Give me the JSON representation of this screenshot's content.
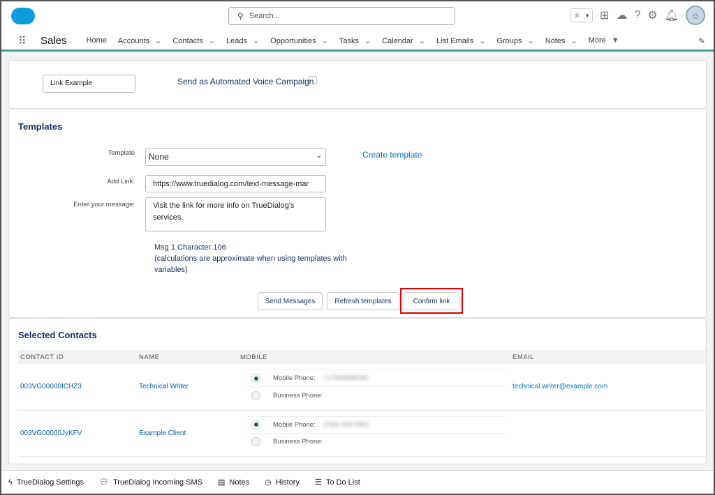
{
  "header": {
    "search_placeholder": "Search...",
    "icons": [
      "star-icon",
      "plus-icon",
      "trailhead-icon",
      "help-icon",
      "gear-icon",
      "bell-icon",
      "avatar"
    ]
  },
  "nav": {
    "app_name": "Sales",
    "items": [
      {
        "label": "Home",
        "dropdown": false
      },
      {
        "label": "Accounts",
        "dropdown": true
      },
      {
        "label": "Contacts",
        "dropdown": true
      },
      {
        "label": "Leads",
        "dropdown": true
      },
      {
        "label": "Opportunities",
        "dropdown": true
      },
      {
        "label": "Tasks",
        "dropdown": true
      },
      {
        "label": "Calendar",
        "dropdown": true
      },
      {
        "label": "List Emails",
        "dropdown": true
      },
      {
        "label": "Groups",
        "dropdown": true
      },
      {
        "label": "Notes",
        "dropdown": true
      },
      {
        "label": "More",
        "dropdown": true
      }
    ]
  },
  "top_card": {
    "campaign_name": "Link Example",
    "voice_label": "Send as Automated Voice Campaign",
    "voice_checked": false
  },
  "templates": {
    "title": "Templates",
    "template_label": "Template",
    "template_value": "None",
    "create_template": "Create template",
    "add_link_label": "Add Link:",
    "add_link_value": "https://www.truedialog.com/text-message-mar",
    "message_label": "Enter your message:",
    "message_value": "Visit the link for more info on TrueDialog's services.",
    "msg_count": "Msg 1 Character 106",
    "msg_note": "(calculations are approximate when using templates with variables)",
    "buttons": {
      "send": "Send Messages",
      "refresh": "Refresh templates",
      "confirm": "Confirm link"
    },
    "highlight_color": "#e00000"
  },
  "contacts": {
    "title": "Selected Contacts",
    "columns": [
      "CONTACT ID",
      "NAME",
      "MOBILE",
      "EMAIL"
    ],
    "rows": [
      {
        "id": "003VG00000ICHZ3",
        "name": "Technical Writer",
        "mobile_label": "Mobile Phone:",
        "mobile": "+17603848182",
        "business_label": "Business Phone:",
        "email": "technical.writer@example.com"
      },
      {
        "id": "003VG00000JyKFV",
        "name": "Example Client",
        "mobile_label": "Mobile Phone:",
        "mobile": "(760) 428-0951",
        "business_label": "Business Phone:",
        "email": ""
      }
    ]
  },
  "footer": {
    "items": [
      {
        "label": "TrueDialog Settings",
        "icon": "bolt-icon"
      },
      {
        "label": "TrueDialog Incoming SMS",
        "icon": "chat-icon"
      },
      {
        "label": "Notes",
        "icon": "note-icon"
      },
      {
        "label": "History",
        "icon": "clock-icon"
      },
      {
        "label": "To Do List",
        "icon": "list-icon"
      }
    ]
  }
}
